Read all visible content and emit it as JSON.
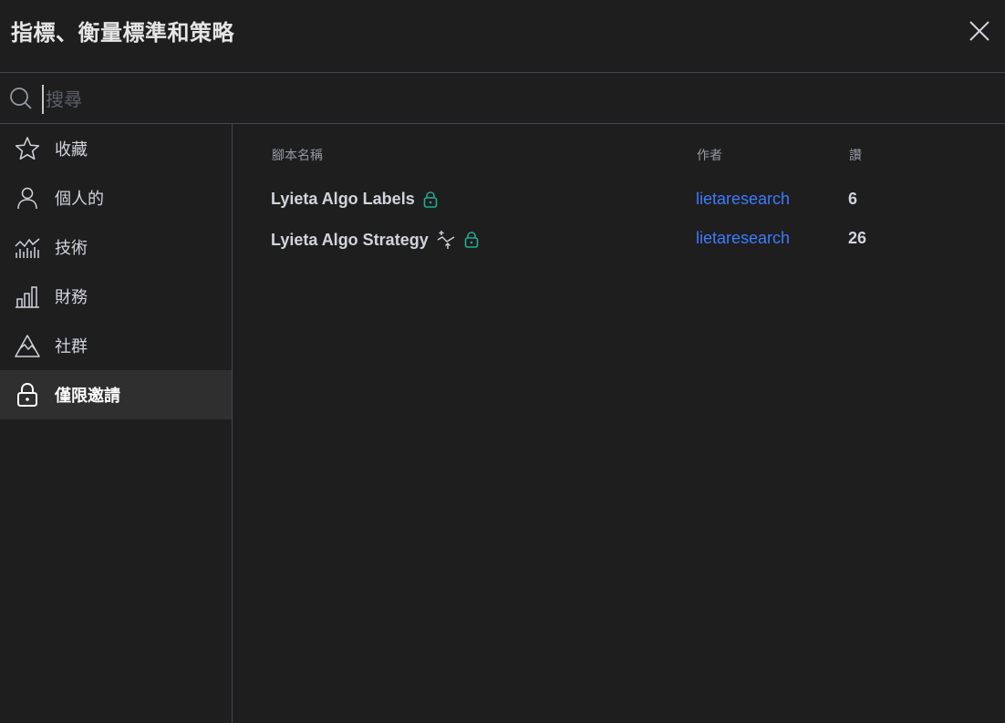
{
  "dialog": {
    "title": "指標、衡量標準和策略",
    "close_icon": "close-icon"
  },
  "search": {
    "placeholder": "搜尋",
    "value": "",
    "icon": "search-icon"
  },
  "sidebar": {
    "items": [
      {
        "label": "收藏",
        "icon": "star-icon",
        "active": false
      },
      {
        "label": "個人的",
        "icon": "user-icon",
        "active": false
      },
      {
        "label": "技術",
        "icon": "chart-line-icon",
        "active": false
      },
      {
        "label": "財務",
        "icon": "bar-chart-icon",
        "active": false
      },
      {
        "label": "社群",
        "icon": "mountain-icon",
        "active": false
      },
      {
        "label": "僅限邀請",
        "icon": "lock-icon",
        "active": true
      }
    ]
  },
  "table": {
    "columns": {
      "name": "腳本名稱",
      "author": "作者",
      "likes": "讚"
    },
    "rows": [
      {
        "name": "Lyieta Algo Labels",
        "author": "lietaresearch",
        "likes": "6",
        "icons": [
          "lock-icon"
        ]
      },
      {
        "name": "Lyieta Algo Strategy",
        "author": "lietaresearch",
        "likes": "26",
        "icons": [
          "strategy-icon",
          "lock-icon"
        ]
      }
    ]
  },
  "colors": {
    "background": "#1e1e1e",
    "active_item": "#2f2f2f",
    "accent_link": "#3d7bff",
    "lock_green": "#22ab94"
  }
}
